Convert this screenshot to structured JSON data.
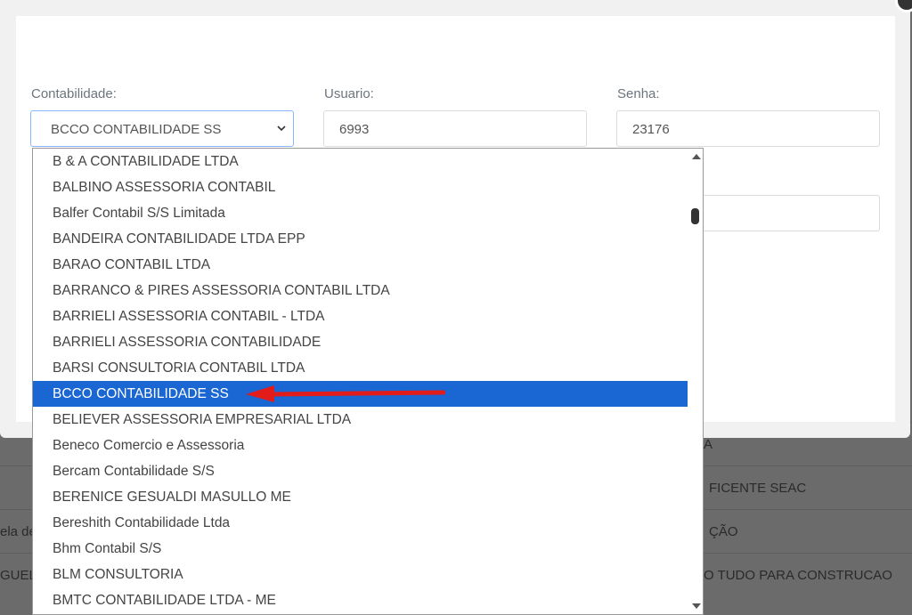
{
  "modal": {
    "contabilidade": {
      "label": "Contabilidade:",
      "value": "BCCO CONTABILIDADE SS"
    },
    "usuario": {
      "label": "Usuario:",
      "value": "6993"
    },
    "senha": {
      "label": "Senha:",
      "value": "23176"
    }
  },
  "dropdown": {
    "options": [
      "B & A CONTABILIDADE LTDA",
      "BALBINO ASSESSORIA CONTABIL",
      "Balfer Contabil S/S Limitada",
      "BANDEIRA CONTABILIDADE LTDA EPP",
      "BARAO CONTABIL LTDA",
      "BARRANCO & PIRES ASSESSORIA CONTABIL LTDA",
      "BARRIELI ASSESSORIA CONTABIL - LTDA",
      "BARRIELI ASSESSORIA CONTABILIDADE",
      "BARSI CONSULTORIA CONTABIL LTDA",
      "BCCO CONTABILIDADE SS",
      "BELIEVER ASSESSORIA EMPRESARIAL LTDA",
      "Beneco Comercio e Assessoria",
      "Bercam Contabilidade S/S",
      "BERENICE GESUALDI MASULLO ME",
      "Bereshith Contabilidade Ltda",
      "Bhm Contabil S/S",
      "BLM CONSULTORIA",
      "BMTC CONTABILIDADE LTDA - ME"
    ],
    "selected": "BCCO CONTABILIDADE SS"
  },
  "background": {
    "rows": [
      {
        "left": "",
        "right": "A"
      },
      {
        "left": "",
        "right": "FICENTE SEAC"
      },
      {
        "left": "ela de",
        "right": "ÇÃO"
      },
      {
        "left": "GUEL",
        "right": "O TUDO PARA CONSTRUCAO"
      }
    ]
  },
  "colors": {
    "selected_bg": "#1a66d2",
    "arrow": "#e21b1b"
  }
}
